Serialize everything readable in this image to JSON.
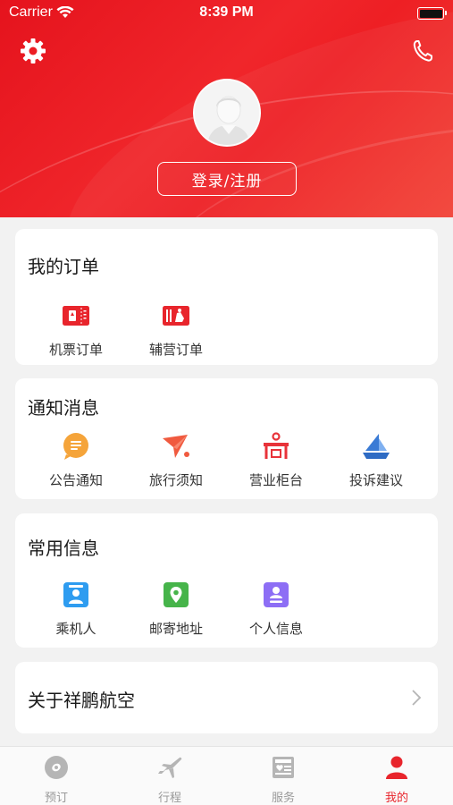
{
  "status_bar": {
    "carrier": "Carrier",
    "time": "8:39 PM"
  },
  "header": {
    "login_label": "登录/注册"
  },
  "orders": {
    "title": "我的订单",
    "items": [
      {
        "label": "机票订单",
        "icon": "ticket-icon"
      },
      {
        "label": "辅营订单",
        "icon": "ancillary-ticket-icon"
      }
    ]
  },
  "notices": {
    "title": "通知消息",
    "items": [
      {
        "label": "公告通知",
        "icon": "announcement-icon"
      },
      {
        "label": "旅行须知",
        "icon": "paper-plane-icon"
      },
      {
        "label": "营业柜台",
        "icon": "counter-icon"
      },
      {
        "label": "投诉建议",
        "icon": "feedback-icon"
      }
    ]
  },
  "common_info": {
    "title": "常用信息",
    "items": [
      {
        "label": "乘机人",
        "icon": "passenger-icon"
      },
      {
        "label": "邮寄地址",
        "icon": "location-icon"
      },
      {
        "label": "个人信息",
        "icon": "profile-icon"
      }
    ]
  },
  "about": {
    "label": "关于祥鹏航空"
  },
  "tabbar": {
    "items": [
      {
        "label": "预订",
        "icon": "booking-icon",
        "active": false
      },
      {
        "label": "行程",
        "icon": "airplane-icon",
        "active": false
      },
      {
        "label": "服务",
        "icon": "service-icon",
        "active": false
      },
      {
        "label": "我的",
        "icon": "person-icon",
        "active": true
      }
    ]
  },
  "colors": {
    "brand_red": "#e8252c",
    "background": "#f2f2f2"
  }
}
